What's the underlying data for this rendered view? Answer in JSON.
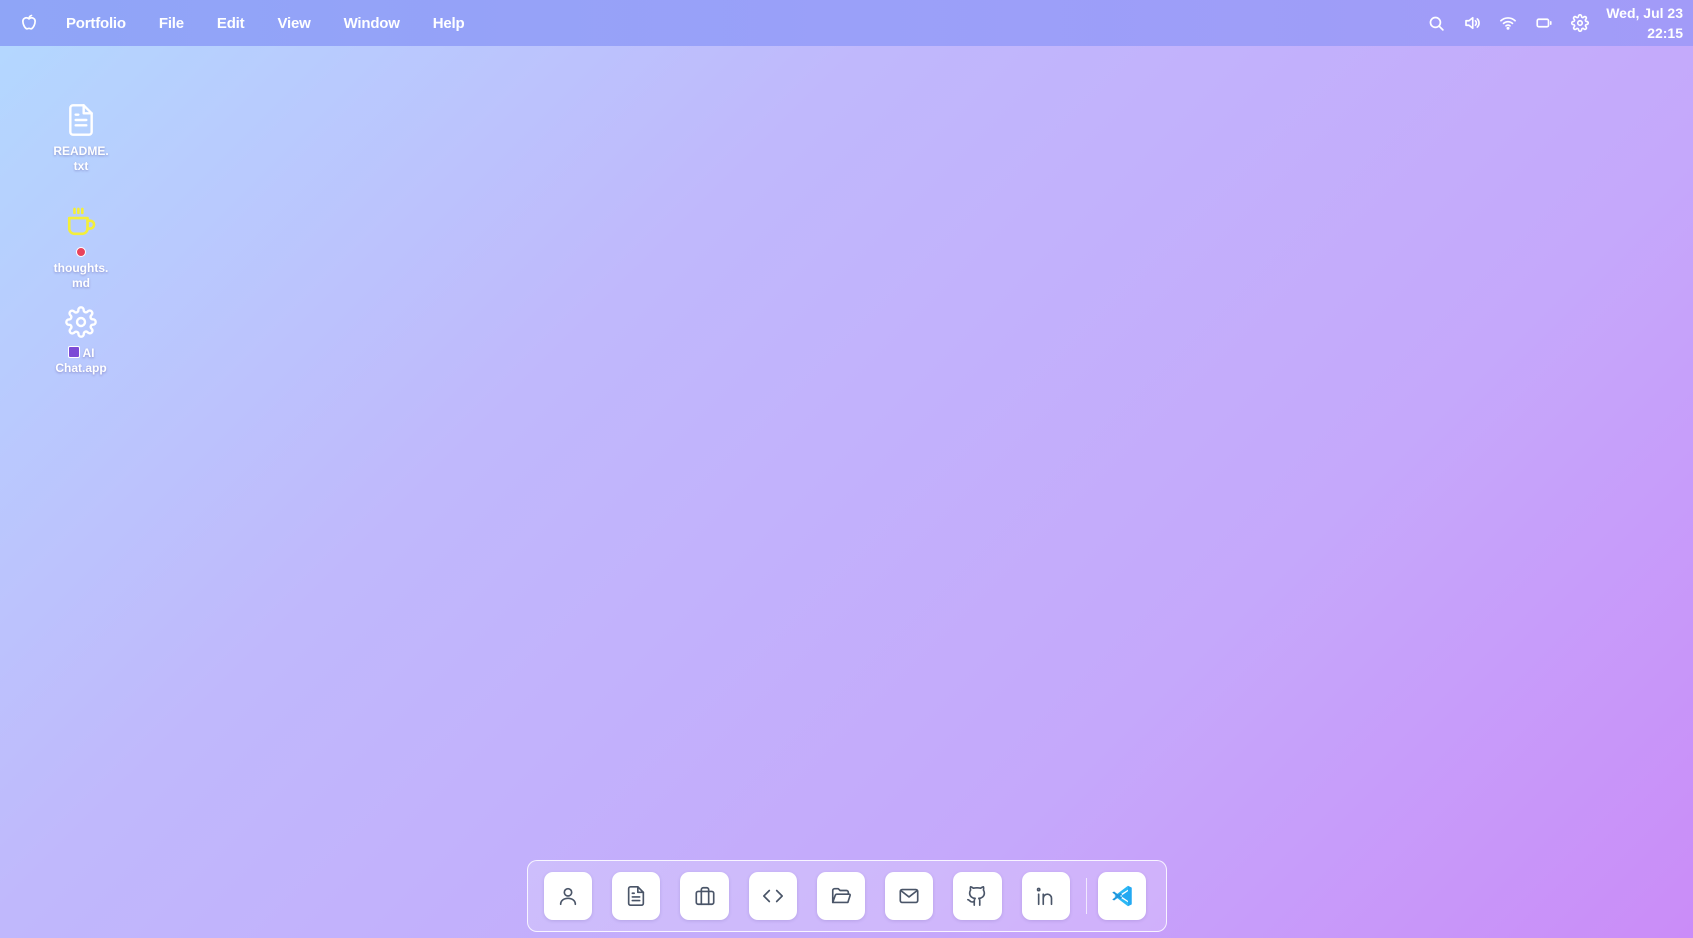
{
  "menubar": {
    "apple_icon": "apple-icon",
    "items": [
      {
        "label": "Portfolio"
      },
      {
        "label": "File"
      },
      {
        "label": "Edit"
      },
      {
        "label": "View"
      },
      {
        "label": "Window"
      },
      {
        "label": "Help"
      }
    ],
    "status_icons": [
      "search-icon",
      "volume-icon",
      "wifi-icon",
      "battery-icon",
      "settings-icon"
    ],
    "clock": {
      "date": "Wed, Jul 23",
      "time": "22:15"
    }
  },
  "desktop": {
    "icons": [
      {
        "label": "README.\ntxt",
        "icon": "document-icon"
      },
      {
        "label": "thoughts.\nmd",
        "icon": "coffee-mug-icon",
        "badge": "red-dot"
      },
      {
        "label": "AI Chat.app",
        "icon": "gear-icon",
        "badge": "robot"
      }
    ]
  },
  "dock": {
    "items": [
      {
        "name": "about",
        "icon": "user-icon"
      },
      {
        "name": "resume",
        "icon": "document-icon"
      },
      {
        "name": "experience",
        "icon": "briefcase-icon"
      },
      {
        "name": "code",
        "icon": "code-icon"
      },
      {
        "name": "projects",
        "icon": "folder-open-icon"
      },
      {
        "name": "mail",
        "icon": "mail-icon"
      },
      {
        "name": "github",
        "icon": "github-icon"
      },
      {
        "name": "linkedin",
        "icon": "linkedin-icon"
      },
      {
        "name": "vscode",
        "icon": "vscode-icon"
      }
    ]
  },
  "colors": {
    "menubar": "#9aa0f9",
    "dock_icon": "#4a5568",
    "vscode": "#23a9f2",
    "coffee": "#f4ef3a"
  }
}
